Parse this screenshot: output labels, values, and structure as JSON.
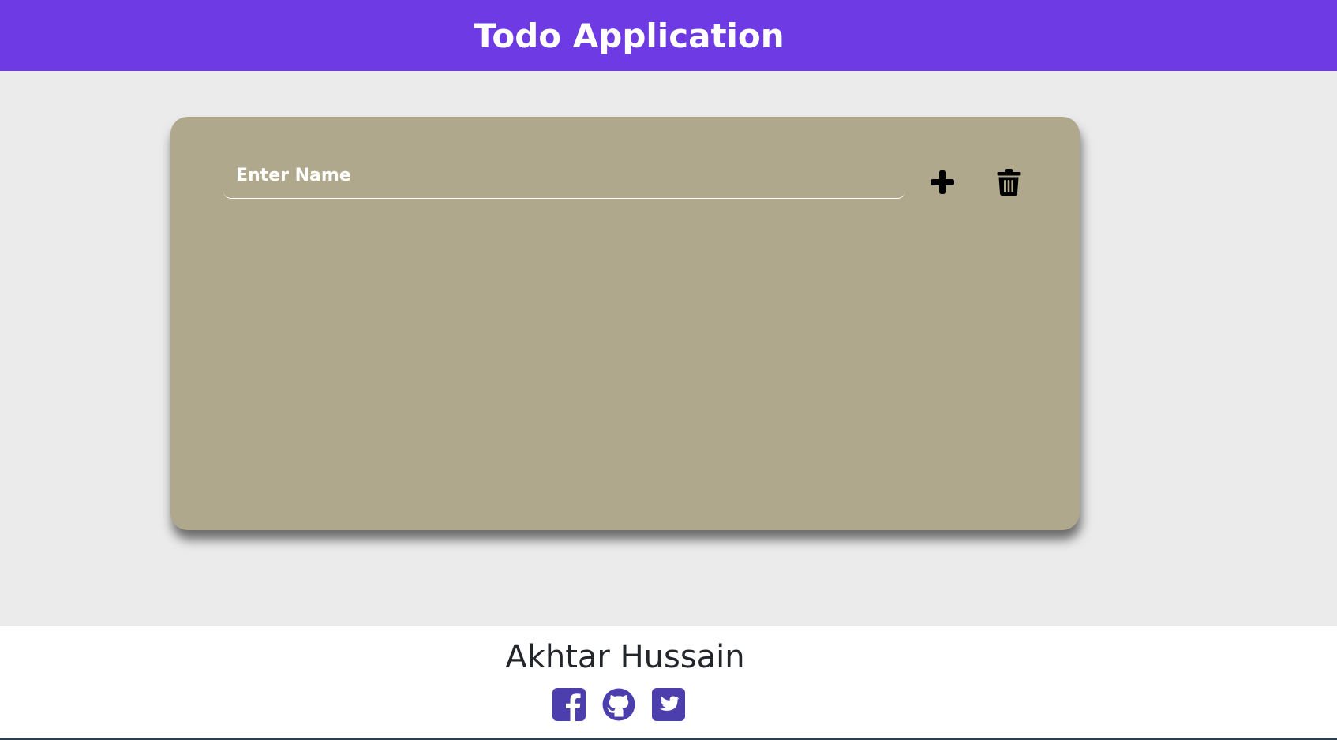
{
  "header": {
    "title": "Todo Application"
  },
  "todo": {
    "input_placeholder": "Enter Name",
    "input_value": "",
    "add_icon": "plus-icon",
    "delete_icon": "trash-icon",
    "items": []
  },
  "footer": {
    "author": "Akhtar Hussain",
    "social": [
      {
        "icon": "facebook-icon"
      },
      {
        "icon": "github-icon"
      },
      {
        "icon": "twitter-icon"
      }
    ]
  },
  "colors": {
    "header_bg": "#6d3ae4",
    "page_bg": "#ecebeb",
    "card_bg": "#afa88c",
    "social_icon": "#4c3fad",
    "footer_text": "#22252a"
  }
}
